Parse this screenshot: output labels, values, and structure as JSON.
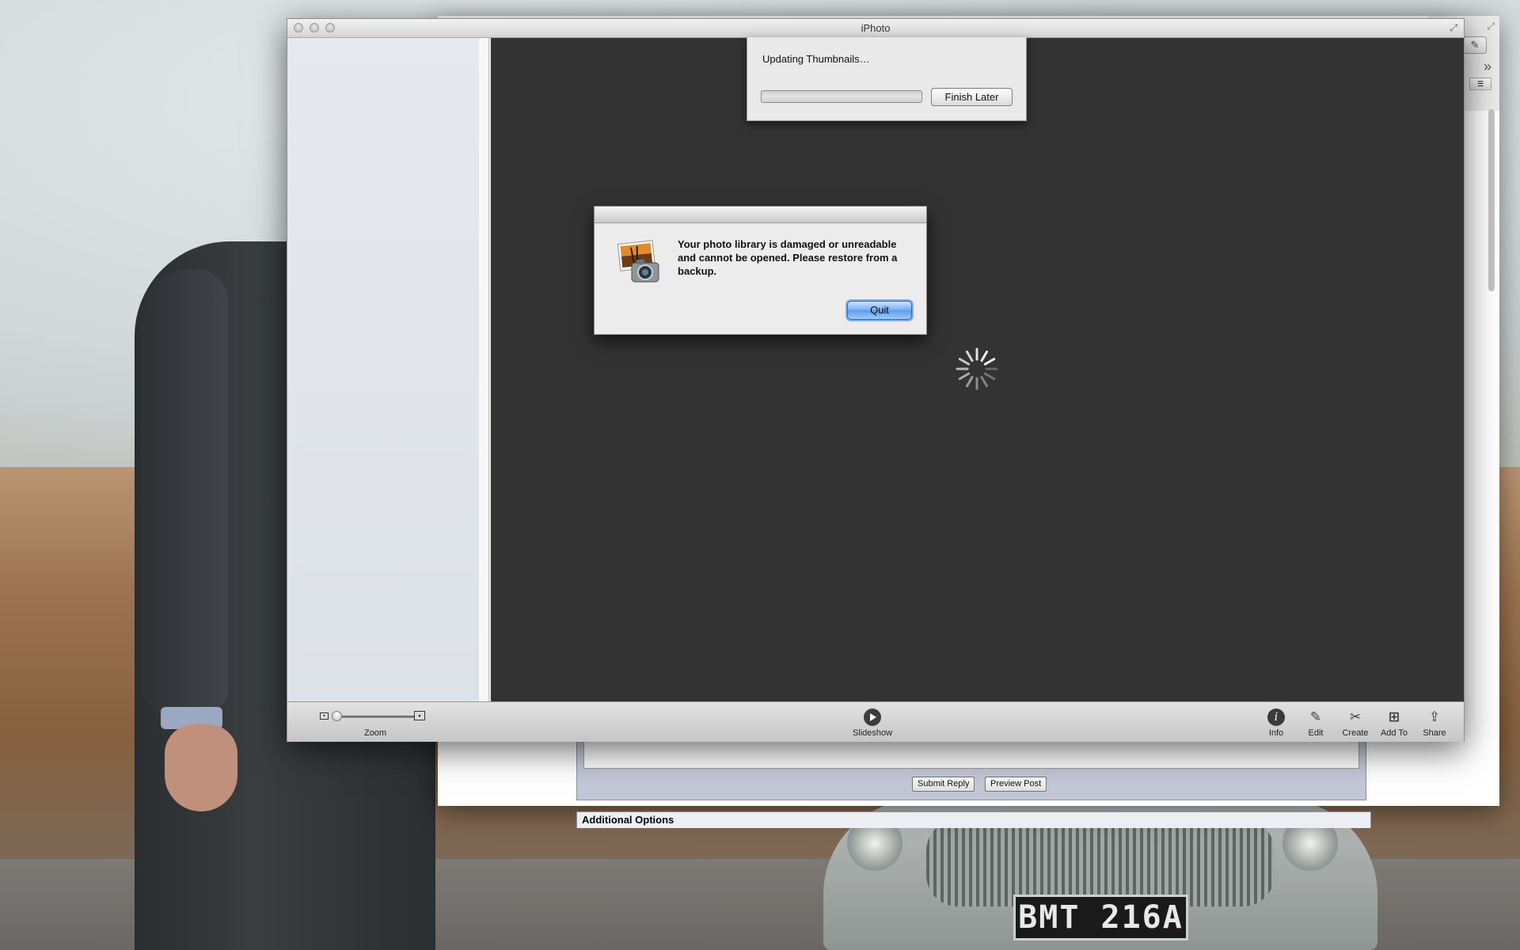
{
  "window": {
    "title": "iPhoto"
  },
  "sheet": {
    "message": "Updating Thumbnails…",
    "progress": 0,
    "finish_later_label": "Finish Later"
  },
  "alert": {
    "message": "Your photo library is damaged or unreadable and cannot be opened. Please restore from a backup.",
    "quit_label": "Quit",
    "icon": "iphoto-app-icon"
  },
  "bottom_bar": {
    "zoom_label": "Zoom",
    "slideshow_label": "Slideshow",
    "info_label": "Info",
    "edit_label": "Edit",
    "create_label": "Create",
    "add_to_label": "Add To",
    "share_label": "Share"
  },
  "background_window": {
    "submit_reply_label": "Submit Reply",
    "preview_post_label": "Preview Post",
    "additional_options_label": "Additional Options"
  },
  "wallpaper": {
    "license_plate": "BMT 216A"
  },
  "colors": {
    "content_bg": "#333333",
    "sidebar_bg": "#e3e6ec",
    "accent_blue": "#5d9de8"
  }
}
